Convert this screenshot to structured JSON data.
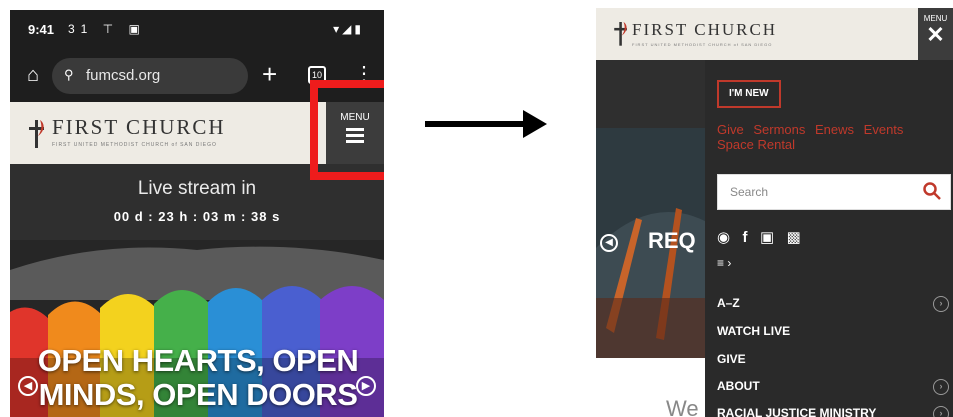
{
  "left_phone": {
    "status": {
      "time": "9:41",
      "icons_left": "31 ⊤ ▣",
      "icons_right": "▾◢▮"
    },
    "url": {
      "text": "fumcsd.org"
    },
    "site": {
      "title": "FIRST CHURCH",
      "subtitle": "FIRST UNITED METHODIST CHURCH of SAN DIEGO"
    },
    "menu_label": "MENU",
    "live": {
      "label": "Live stream in",
      "countdown": "00 d  :  23 h  :  03 m  :  38 s"
    },
    "hero": {
      "line1": "OPEN HEARTS, OPEN",
      "line2": "MINDS, OPEN DOORS"
    }
  },
  "right_phone": {
    "site": {
      "title": "FIRST CHURCH",
      "subtitle": "FIRST UNITED METHODIST CHURCH of SAN DIEGO"
    },
    "menu_label": "MENU",
    "close_glyph": "✕",
    "background_text": {
      "req": "REQ",
      "we": "We"
    },
    "menu": {
      "im_new": "I'M NEW",
      "quicklinks": [
        "Give",
        "Sermons",
        "Enews",
        "Events",
        "Space Rental"
      ],
      "search_placeholder": "Search",
      "nav_items": [
        {
          "label": "A–Z",
          "has_chevron": true
        },
        {
          "label": "WATCH LIVE",
          "has_chevron": false
        },
        {
          "label": "GIVE",
          "has_chevron": false
        },
        {
          "label": "ABOUT",
          "has_chevron": true
        },
        {
          "label": "RACIAL JUSTICE MINISTRY",
          "has_chevron": true
        }
      ]
    }
  },
  "colors": {
    "highlight": "#ee1c1c",
    "accent_red": "#c0392b",
    "dark_bg": "#2f2f2f",
    "header_bg": "#eeebe4"
  }
}
